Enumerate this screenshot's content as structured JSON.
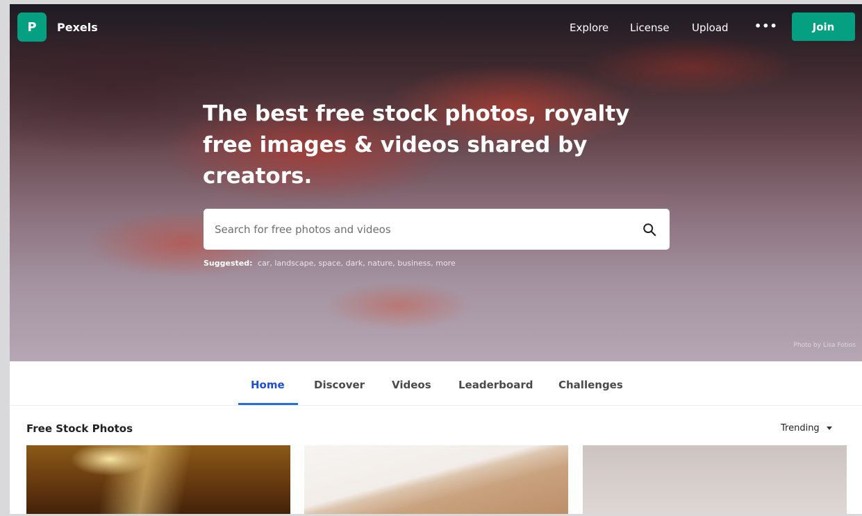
{
  "brand": {
    "logo_letter": "P",
    "name": "Pexels",
    "accent_color": "#05a081"
  },
  "nav": {
    "links": [
      "Explore",
      "License",
      "Upload"
    ],
    "more_label": "•••",
    "join_label": "Join"
  },
  "hero": {
    "headline": "The best free stock photos, royalty free images & videos shared by creators.",
    "search_placeholder": "Search for free photos and videos",
    "search_icon": "search-icon",
    "suggested_label": "Suggested:",
    "suggestions": [
      "car,",
      "landscape,",
      "space,",
      "dark,",
      "nature,",
      "business,",
      "more"
    ],
    "credit": "Photo by Lisa Fotios"
  },
  "tabs": {
    "items": [
      "Home",
      "Discover",
      "Videos",
      "Leaderboard",
      "Challenges"
    ],
    "active": "Home",
    "active_color": "#1f4fd1"
  },
  "section": {
    "title": "Free Stock Photos",
    "sort_label": "Trending"
  }
}
